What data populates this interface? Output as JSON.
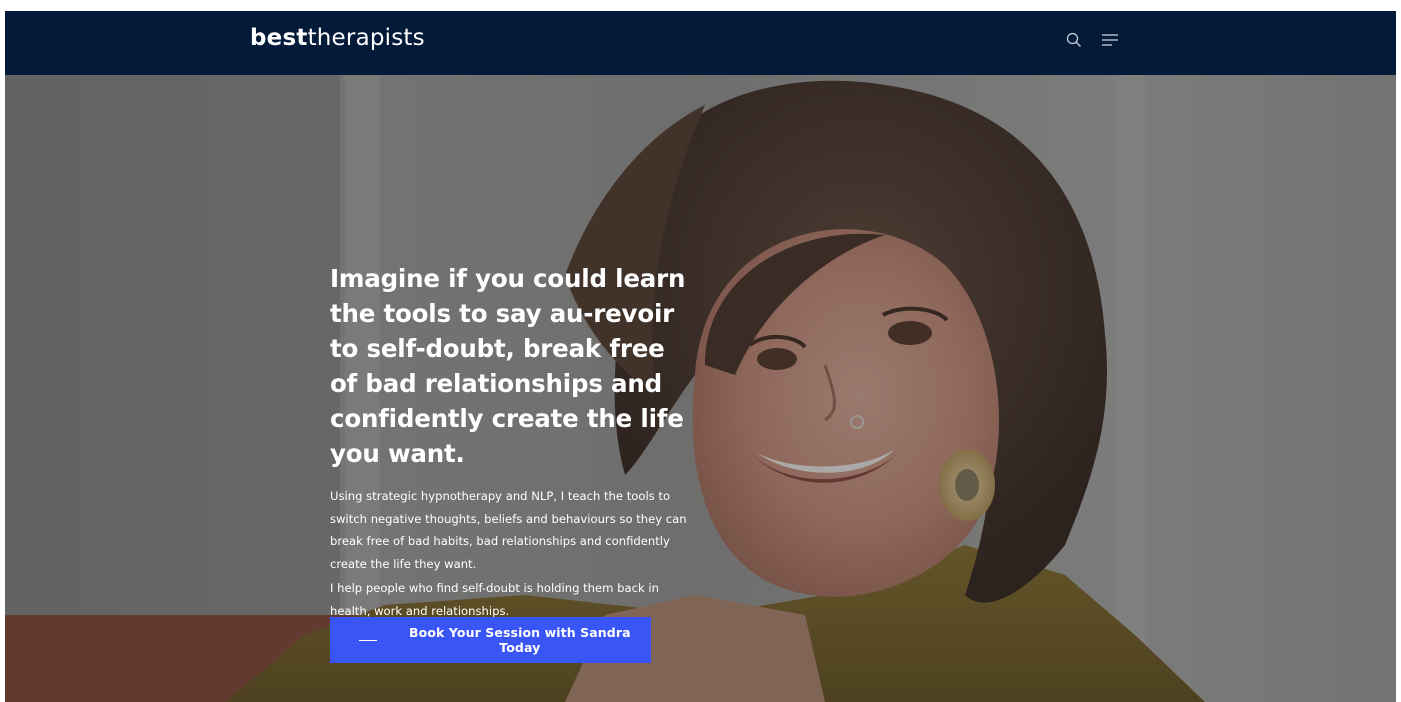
{
  "header": {
    "logo": {
      "strong": "best",
      "light": "therapists"
    },
    "icons": {
      "search": "search-icon",
      "menu": "menu-icon"
    },
    "background": "#031a38"
  },
  "hero": {
    "photo": "portrait-photo",
    "headline": "Imagine if you could learn the tools to say au-revoir to self-doubt, break free of bad relationships and confidently create the life you want.",
    "paragraphs": [
      "Using strategic hypnotherapy and NLP, I teach the tools to switch negative thoughts, beliefs and behaviours so they can break free of bad habits, bad relationships and confidently create the life they want.",
      "I help people who find self-doubt is holding them back in health, work and relationships."
    ],
    "cta": {
      "label": "Book Your Session with Sandra Today",
      "color": "#3a55f5"
    }
  }
}
